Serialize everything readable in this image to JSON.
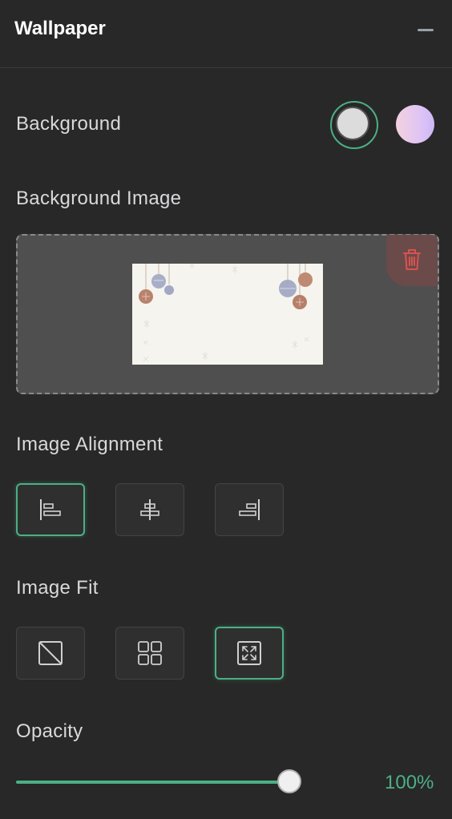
{
  "header": {
    "title": "Wallpaper",
    "collapse_icon": "minus-icon"
  },
  "background": {
    "label": "Background",
    "swatches": [
      {
        "name": "solid-gray",
        "color": "#dcdcdc",
        "selected": true
      },
      {
        "name": "pink-lavender-gradient",
        "color": "#e0c5f4",
        "selected": false
      }
    ]
  },
  "background_image": {
    "label": "Background Image",
    "delete_icon": "trash-icon"
  },
  "alignment": {
    "label": "Image Alignment",
    "options": [
      {
        "name": "align-left",
        "selected": true
      },
      {
        "name": "align-center",
        "selected": false
      },
      {
        "name": "align-right",
        "selected": false
      }
    ]
  },
  "fit": {
    "label": "Image Fit",
    "options": [
      {
        "name": "no-fit",
        "selected": false
      },
      {
        "name": "tile",
        "selected": false
      },
      {
        "name": "fit-expand",
        "selected": true
      }
    ]
  },
  "opacity": {
    "label": "Opacity",
    "value": 1,
    "value_text": "100%"
  },
  "colors": {
    "accent": "#4caf86",
    "panel": "#282828",
    "delete_bg": "#6b4a4a",
    "delete_icon": "#d9534f"
  }
}
